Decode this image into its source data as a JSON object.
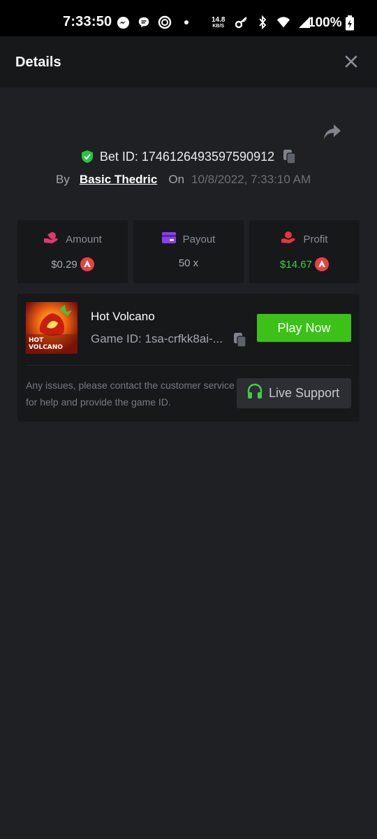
{
  "status_bar": {
    "time": "7:33:50",
    "net_speed_value": "14.8",
    "net_speed_unit": "KB/S",
    "battery": "100%"
  },
  "header": {
    "title": "Details"
  },
  "bet": {
    "id_label": "Bet ID: 1746126493597590912",
    "by_label": "By",
    "user": "Basic Thedric",
    "on_label": "On",
    "date": "10/8/2022, 7:33:10 AM"
  },
  "stats": [
    {
      "label": "Amount",
      "value": "$0.29",
      "icon": "money-hand-icon"
    },
    {
      "label": "Payout",
      "value": "50 x",
      "icon": "card-icon"
    },
    {
      "label": "Profit",
      "value": "$14.67",
      "icon": "profit-hand-icon"
    }
  ],
  "game": {
    "thumb_title_line1": "HOT",
    "thumb_title_line2": "VOLCANO",
    "name": "Hot Volcano",
    "id_text": "Game ID: 1sa-crfkk8ai-...",
    "play_label": "Play Now"
  },
  "support": {
    "help_text": "Any issues, please contact the customer service for help and provide the game ID.",
    "button_label": "Live Support"
  },
  "colors": {
    "background": "#1f2023",
    "card": "#17181a",
    "accent_green": "#3bc117",
    "profit_green": "#3cd23f",
    "coin_red": "#e84142",
    "amount_pink": "#e0396e",
    "payout_purple": "#8a3ff0",
    "profit_red": "#e8343b"
  }
}
